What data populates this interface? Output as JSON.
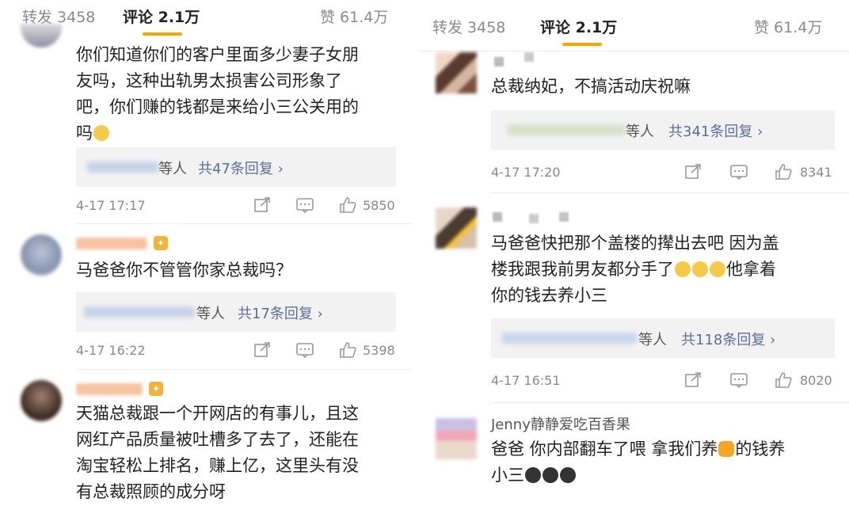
{
  "left": {
    "tabs": {
      "repost": "转发 3458",
      "comments": "评论 2.1万",
      "likes": "赞 61.4万"
    },
    "comments": [
      {
        "lines": [
          "你们知道你们的客户里面多少妻子女朋",
          "友吗，这种出轨男太损害公司形象了",
          "吧，你们赚的钱都是来给小三公关用的",
          "吗"
        ],
        "reply_deng": "等人",
        "reply_link": "共47条回复 ›",
        "time": "4-17 17:17",
        "likes": "5850"
      },
      {
        "lines": [
          "马爸爸你不管管你家总裁吗？"
        ],
        "reply_deng": "等人",
        "reply_link": "共17条回复 ›",
        "time": "4-17 16:22",
        "likes": "5398"
      },
      {
        "lines": [
          "天猫总裁跟一个开网店的有事儿，且这",
          "网红产品质量被吐槽多了去了，还能在",
          "淘宝轻松上排名，赚上亿，这里头有没",
          "有总裁照顾的成分呀"
        ]
      }
    ]
  },
  "right": {
    "tabs": {
      "repost": "转发 3458",
      "comments": "评论 2.1万",
      "likes": "赞 61.4万"
    },
    "comments": [
      {
        "lines": [
          "总裁纳妃，不搞活动庆祝嘛"
        ],
        "reply_deng": "等人",
        "reply_link": "共341条回复 ›",
        "time": "4-17 17:20",
        "likes": "8341"
      },
      {
        "lines": [
          "马爸爸快把那个盖楼的撵出去吧  因为盖",
          "楼我跟我前男友都分手了",
          "你的钱去养小三"
        ],
        "line2_tail": "他拿着",
        "reply_deng": "等人",
        "reply_link": "共118条回复 ›",
        "time": "4-17 16:51",
        "likes": "8020"
      },
      {
        "name": "Jenny静静爱吃百香果",
        "lines": [
          "爸爸  你内部翻车了喂  拿我们养",
          "小三"
        ],
        "line1_tail": "的钱养"
      }
    ]
  }
}
